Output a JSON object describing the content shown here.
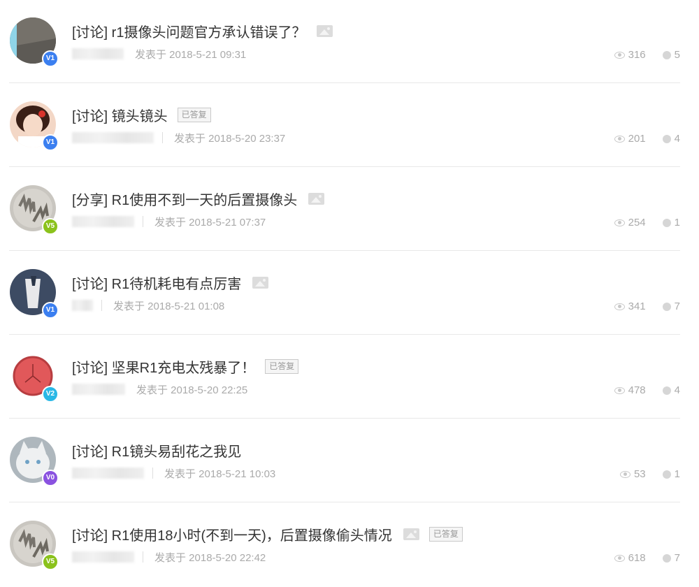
{
  "posts": [
    {
      "title": "[讨论] r1摄像头问题官方承认错误了？",
      "has_image": true,
      "answered": false,
      "posted": "发表于 2018-5-21 09:31",
      "views": "316",
      "replies": "5",
      "level": "V1",
      "level_color": "#3b7ff0",
      "avatar_style": "grey-panel"
    },
    {
      "title": "[讨论] 镜头镜头",
      "has_image": false,
      "answered": true,
      "answered_label": "已答复",
      "posted": "发表于 2018-5-20 23:37",
      "views": "201",
      "replies": "4",
      "level": "V1",
      "level_color": "#3b7ff0",
      "avatar_style": "girl-photo"
    },
    {
      "title": "[分享] R1使用不到一天的后置摄像头",
      "has_image": true,
      "answered": false,
      "posted": "发表于 2018-5-21 07:37",
      "views": "254",
      "replies": "1",
      "level": "V5",
      "level_color": "#8bc21c",
      "avatar_style": "stone-hands"
    },
    {
      "title": "[讨论] R1待机耗电有点厉害",
      "has_image": true,
      "answered": false,
      "posted": "发表于 2018-5-21 01:08",
      "views": "341",
      "replies": "7",
      "level": "V1",
      "level_color": "#3b7ff0",
      "avatar_style": "dark-figure"
    },
    {
      "title": "[讨论] 坚果R1充电太残暴了！",
      "has_image": false,
      "answered": true,
      "answered_label": "已答复",
      "posted": "发表于 2018-5-20 22:25",
      "views": "478",
      "replies": "4",
      "level": "V2",
      "level_color": "#2ab8e6",
      "avatar_style": "red-clock"
    },
    {
      "title": "[讨论] R1镜头易刮花之我见",
      "has_image": false,
      "answered": false,
      "posted": "发表于 2018-5-21 10:03",
      "views": "53",
      "replies": "1",
      "level": "V0",
      "level_color": "#8a52e0",
      "avatar_style": "white-cat"
    },
    {
      "title": "[讨论] R1使用18小时(不到一天)，后置摄像偷头情况",
      "has_image": true,
      "answered": true,
      "answered_label": "已答复",
      "posted": "发表于 2018-5-20 22:42",
      "views": "618",
      "replies": "7",
      "level": "V5",
      "level_color": "#8bc21c",
      "avatar_style": "stone-hands"
    }
  ]
}
